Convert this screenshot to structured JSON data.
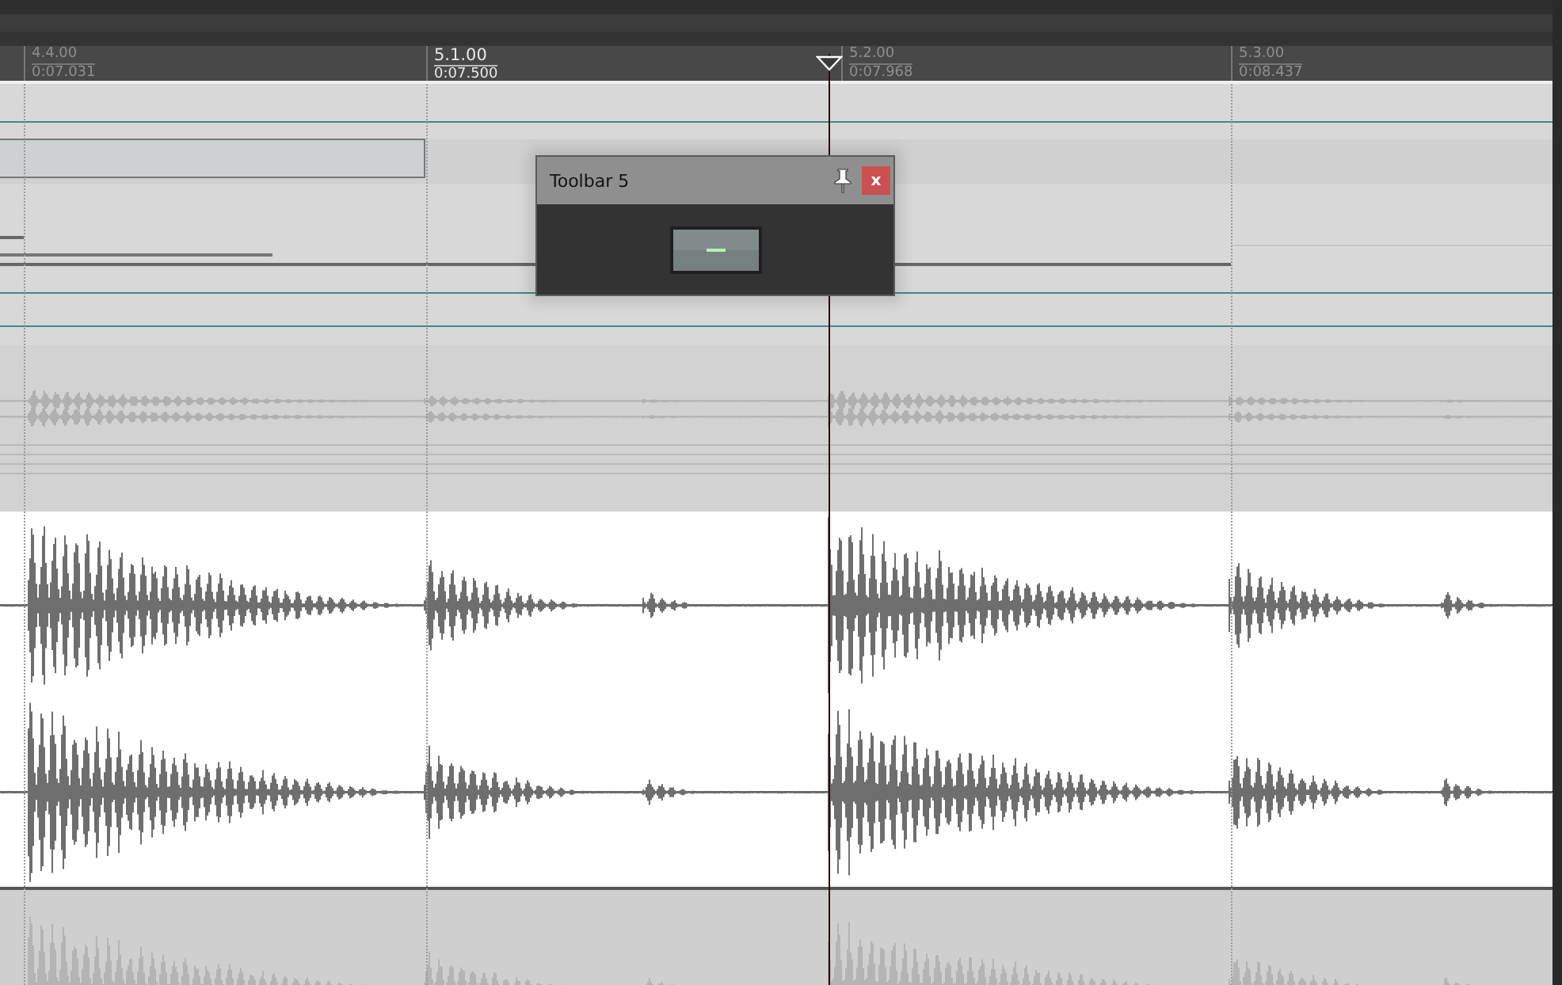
{
  "ruler": {
    "markers": [
      {
        "bar": "4.4.00",
        "time": "0:07.031",
        "emphasized": false
      },
      {
        "bar": "5.1.00",
        "time": "0:07.500",
        "emphasized": true
      },
      {
        "bar": "5.2.00",
        "time": "0:07.968",
        "emphasized": false
      },
      {
        "bar": "5.3.00",
        "time": "0:08.437",
        "emphasized": false
      }
    ]
  },
  "tracks": [
    {
      "kind": "envelopes",
      "selected": false
    },
    {
      "kind": "waveform",
      "selected": false
    },
    {
      "kind": "waveform",
      "selected": true
    },
    {
      "kind": "waveform",
      "selected": false
    }
  ],
  "toolbar_window": {
    "title": "Toolbar 5",
    "close_label": "x",
    "pinned": true
  }
}
